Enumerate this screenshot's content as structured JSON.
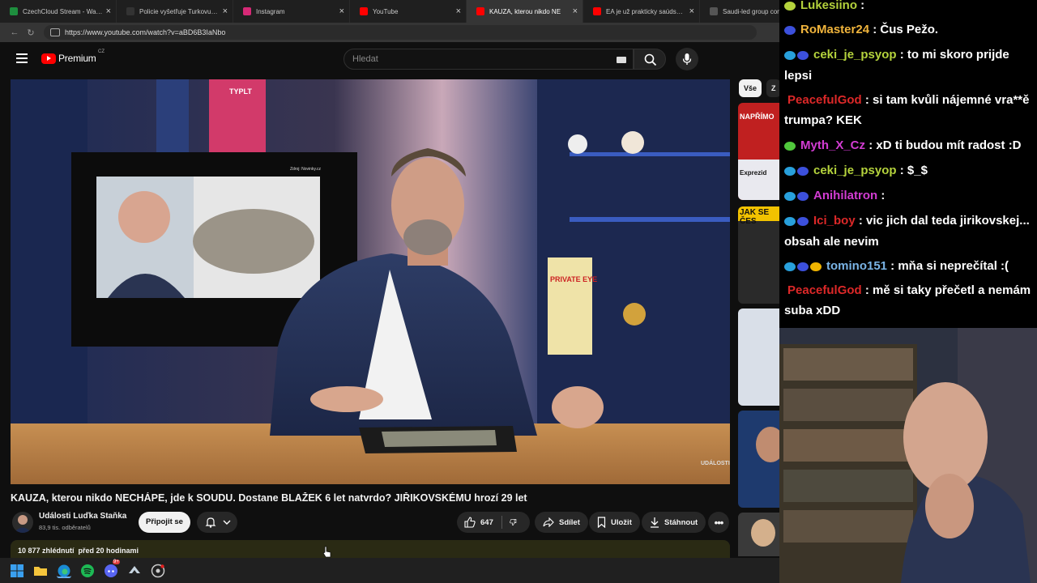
{
  "browser": {
    "tabs": [
      {
        "label": "CzechCloud Stream - Watch",
        "favicon_color": "#1e8e3e",
        "active": false
      },
      {
        "label": "Policie vyšetřuje Turkovu nel",
        "favicon_color": "#333333",
        "active": false
      },
      {
        "label": "Instagram",
        "favicon_color": "#d62976",
        "active": false
      },
      {
        "label": "YouTube",
        "favicon_color": "#ff0000",
        "active": false
      },
      {
        "label": "KAUZA, kterou nikdo NE",
        "favicon_color": "#ff0000",
        "active": true
      },
      {
        "label": "EA je už prakticky saúdská, E",
        "favicon_color": "#ff0000",
        "active": false
      },
      {
        "label": "Saudi-led group complet",
        "favicon_color": "#555555",
        "active": false
      }
    ],
    "url": "https://www.youtube.com/watch?v=aBD6B3IaNbo"
  },
  "youtube": {
    "logo_text": "Premium",
    "country_code": "CZ",
    "search_placeholder": "Hledat",
    "video_title": "KAUZA, kterou nikdo NECHÁPE, jde k SOUDU. Dostane BLAŽEK 6 let natvrdo? JIŘIKOVSKÉMU hrozí 29 let",
    "channel_name": "Události Luďka Staňka",
    "subscribers": "83,9 tis. odběratelů",
    "join_label": "Připojit se",
    "like_count": "647",
    "share_label": "Sdílet",
    "save_label": "Uložit",
    "download_label": "Stáhnout",
    "views_info": "10 877 zhlédnutí  před 20 hodinami",
    "chips": [
      "Vše",
      "Z"
    ],
    "video_overlay": {
      "source_caption": "Zdroj: Novinky.cz",
      "watermark": "UDÁLOSTI",
      "shelf_text_1": "TYPLT",
      "shelf_text_2": "PRIVATE EYE"
    },
    "recommendations": [
      {
        "text": "NAPŘÍMO",
        "subtext": "Exprezid"
      },
      {
        "text": "JAK SE ČES",
        "subtext": ""
      }
    ]
  },
  "chat": {
    "messages": [
      {
        "user": "Lukesiino",
        "user_color": "#b4d23c",
        "text": " : ",
        "badges": [
          "#b4d23c"
        ]
      },
      {
        "user": "RoMaster24",
        "user_color": "#f0b43c",
        "text": " : Čus Pežo.",
        "badges": [
          "#3c50dc"
        ]
      },
      {
        "user": "ceki_je_psyop",
        "user_color": "#b4d23c",
        "text": " : to mi skoro prijde lepsi",
        "badges": [
          "#28a0dc",
          "#3c50dc"
        ]
      },
      {
        "user": "PeacefulGod",
        "user_color": "#dc2828",
        "text": " : si tam kvůli nájemné vra**ě trumpa? KEK",
        "badges": []
      },
      {
        "user": "Myth_X_Cz",
        "user_color": "#d23cd2",
        "text": " : xD ti budou mít radost :D",
        "badges": [
          "#50c83c"
        ]
      },
      {
        "user": "ceki_je_psyop",
        "user_color": "#b4d23c",
        "text": " : $_$",
        "badges": [
          "#28a0dc",
          "#3c50dc"
        ]
      },
      {
        "user": "Anihilatron",
        "user_color": "#d23cd2",
        "text": " : ",
        "badges": [
          "#28a0dc",
          "#3c50dc"
        ]
      },
      {
        "user": "Ici_boy",
        "user_color": "#dc2828",
        "text": " : vic jich dal teda jirikovskej... obsah ale nevim",
        "badges": [
          "#28a0dc",
          "#3c50dc"
        ]
      },
      {
        "user": "tomino151",
        "user_color": "#7ab4e6",
        "text": " : mňa si neprečítal :(",
        "badges": [
          "#28a0dc",
          "#3c50dc",
          "#f0b400"
        ]
      },
      {
        "user": "PeacefulGod",
        "user_color": "#dc2828",
        "text": " : mě si taky přečetl a nemám suba xDD",
        "badges": []
      }
    ]
  },
  "taskbar": {
    "icons": [
      "windows-start",
      "file-explorer",
      "edge",
      "spotify",
      "discord",
      "steam",
      "obs"
    ],
    "discord_badge": "9+"
  }
}
